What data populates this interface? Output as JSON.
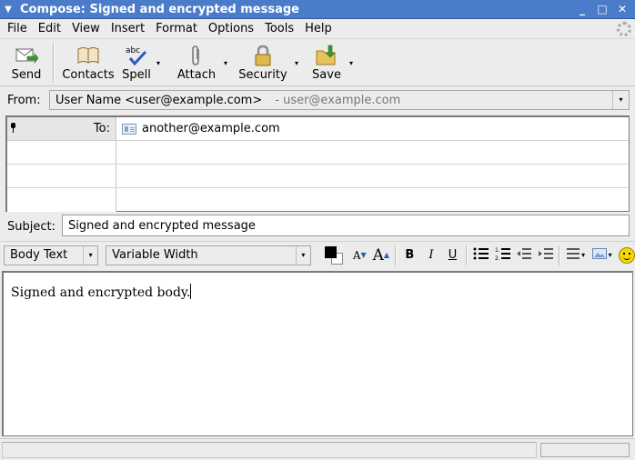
{
  "window": {
    "title": "Compose: Signed and encrypted message",
    "menu_glyph": "▼",
    "minimize_glyph": "_",
    "maximize_glyph": "□",
    "close_glyph": "✕"
  },
  "menubar": {
    "items": [
      "File",
      "Edit",
      "View",
      "Insert",
      "Format",
      "Options",
      "Tools",
      "Help"
    ]
  },
  "toolbar": {
    "send": "Send",
    "contacts": "Contacts",
    "spell": "Spell",
    "attach": "Attach",
    "security": "Security",
    "save": "Save",
    "arrow": "▾"
  },
  "from": {
    "label": "From:",
    "identity": "User Name <user@example.com>",
    "account": "- user@example.com",
    "arrow": "▾"
  },
  "addressing": {
    "rows": [
      {
        "type": "To:",
        "value": "another@example.com"
      },
      {
        "type": "",
        "value": ""
      },
      {
        "type": "",
        "value": ""
      },
      {
        "type": "",
        "value": ""
      }
    ]
  },
  "subject": {
    "label": "Subject:",
    "value": "Signed and encrypted message"
  },
  "format": {
    "paragraph": "Body Text",
    "font": "Variable Width",
    "arrow": "▾",
    "smaller": "A",
    "larger": "A",
    "bold": "B",
    "italic": "I",
    "underline": "U"
  },
  "body": {
    "text": "Signed and encrypted body."
  },
  "icons": {
    "send": "send-icon",
    "contacts": "address-book-icon",
    "spell": "spellcheck-icon",
    "attach": "paperclip-icon",
    "security": "padlock-icon",
    "save": "save-folder-icon",
    "bullets": "bullet-list-icon",
    "numbers": "numbered-list-icon",
    "outdent": "outdent-icon",
    "indent": "indent-icon",
    "align": "align-icon",
    "insert": "insert-image-icon",
    "smiley": "smiley-icon"
  }
}
